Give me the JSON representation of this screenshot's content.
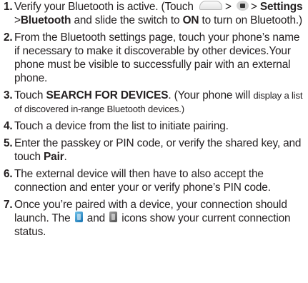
{
  "steps": [
    {
      "num": "1.",
      "a": "Verify your Bluetooth is active. (Touch",
      "gt1": ">",
      "gt2": ">",
      "settings": "Settings",
      "gt3": ">",
      "bluetooth": "Bluetooth",
      "b": "and slide the switch to",
      "on": "ON",
      "c": "to turn on Bluetooth.)",
      "icons": {
        "home": "home-icon",
        "menu": "menu-icon"
      }
    },
    {
      "num": "2.",
      "text": "From the Bluetooth settings page, touch your phone’s name if necessary to make it discoverable by other devices.Your phone must be visible to successfully pair with an external phone."
    },
    {
      "num": "3.",
      "a": "Touch",
      "search": "SEARCH FOR DEVICES",
      "b": ".",
      "c": "(Your phone will",
      "small": "display a list of discovered in-range Bluetooth devices.)"
    },
    {
      "num": "4.",
      "text": "Touch a device from the list to initiate pairing."
    },
    {
      "num": "5.",
      "a": "Enter the passkey or PIN code, or verify the shared key, and touch",
      "pair": "Pair",
      "b": "."
    },
    {
      "num": "6.",
      "text": "The external device will then have to also accept the connection and enter your or verify phone’s PIN code."
    },
    {
      "num": "7.",
      "a": "Once you’re paired with a device, your connection should launch. The",
      "and": "and",
      "b": "icons show your current connection status.",
      "icons": {
        "connected": "bluetooth-connected-icon",
        "status": "bluetooth-status-icon"
      },
      "colors": {
        "connected": "#2a8fd0",
        "status": "#6a6a6a"
      }
    }
  ]
}
